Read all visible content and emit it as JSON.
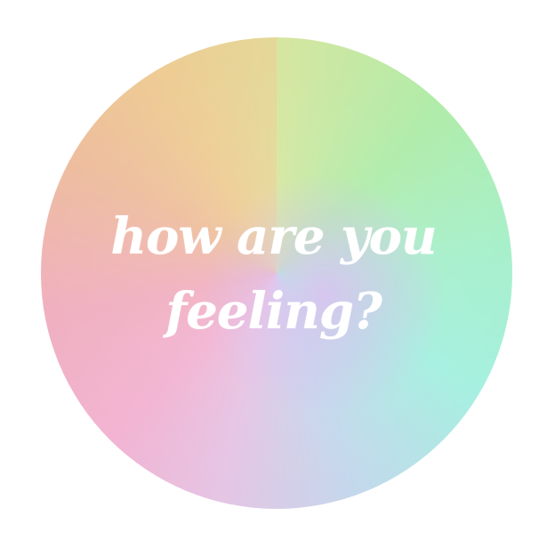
{
  "graphic": {
    "line_1": "how are you",
    "line_2": "feeling?"
  },
  "colors": {
    "text": "#ffffff",
    "background": "#ffffff",
    "gradient_stops": [
      "#eecc94",
      "#b0ecaa",
      "#a6f0e0",
      "#f2b4d2",
      "#d6beee"
    ]
  }
}
